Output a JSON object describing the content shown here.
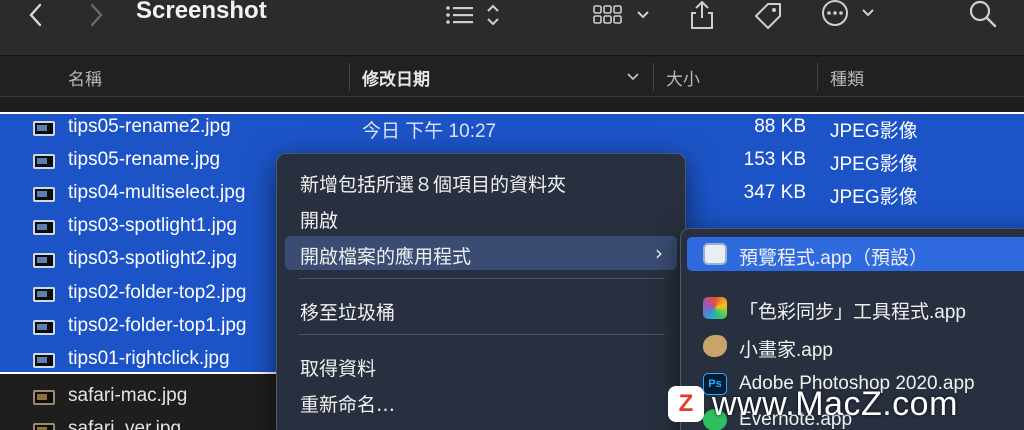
{
  "toolbar": {
    "title": "Screenshot",
    "back_icon": "chevron-left-icon",
    "forward_icon": "chevron-right-icon"
  },
  "columns": {
    "name": "名稱",
    "date": "修改日期",
    "size": "大小",
    "kind": "種類"
  },
  "files": [
    {
      "name": "tips05-rename2.jpg",
      "date": "今日 下午 10:27",
      "size": "88 KB",
      "kind": "JPEG影像",
      "selected": true
    },
    {
      "name": "tips05-rename.jpg",
      "date": "",
      "size": "153 KB",
      "kind": "JPEG影像",
      "selected": true
    },
    {
      "name": "tips04-multiselect.jpg",
      "date": "",
      "size": "347 KB",
      "kind": "JPEG影像",
      "selected": true
    },
    {
      "name": "tips03-spotlight1.jpg",
      "date": "",
      "size": "",
      "kind": "",
      "selected": true
    },
    {
      "name": "tips03-spotlight2.jpg",
      "date": "",
      "size": "",
      "kind": "",
      "selected": true
    },
    {
      "name": "tips02-folder-top2.jpg",
      "date": "",
      "size": "",
      "kind": "",
      "selected": true
    },
    {
      "name": "tips02-folder-top1.jpg",
      "date": "",
      "size": "",
      "kind": "",
      "selected": true
    },
    {
      "name": "tips01-rightclick.jpg",
      "date": "",
      "size": "",
      "kind": "",
      "selected": true
    },
    {
      "name": "safari-mac.jpg",
      "date": "",
      "size": "",
      "kind": "",
      "selected": false
    },
    {
      "name": "safari_ver.jpg",
      "date": "",
      "size": "",
      "kind": "",
      "selected": false
    }
  ],
  "context_menu": {
    "items": [
      "新增包括所選８個項目的資料夾",
      "開啟",
      "開啟檔案的應用程式",
      "移至垃圾桶",
      "取得資料",
      "重新命名…"
    ]
  },
  "submenu": {
    "items": [
      "預覽程式.app（預設）",
      "「色彩同步」工具程式.app",
      "小畫家.app",
      "Adobe Photoshop 2020.app",
      "Evernote.app"
    ]
  },
  "watermark": {
    "letter": "Z",
    "text": "www.MacZ.com"
  }
}
